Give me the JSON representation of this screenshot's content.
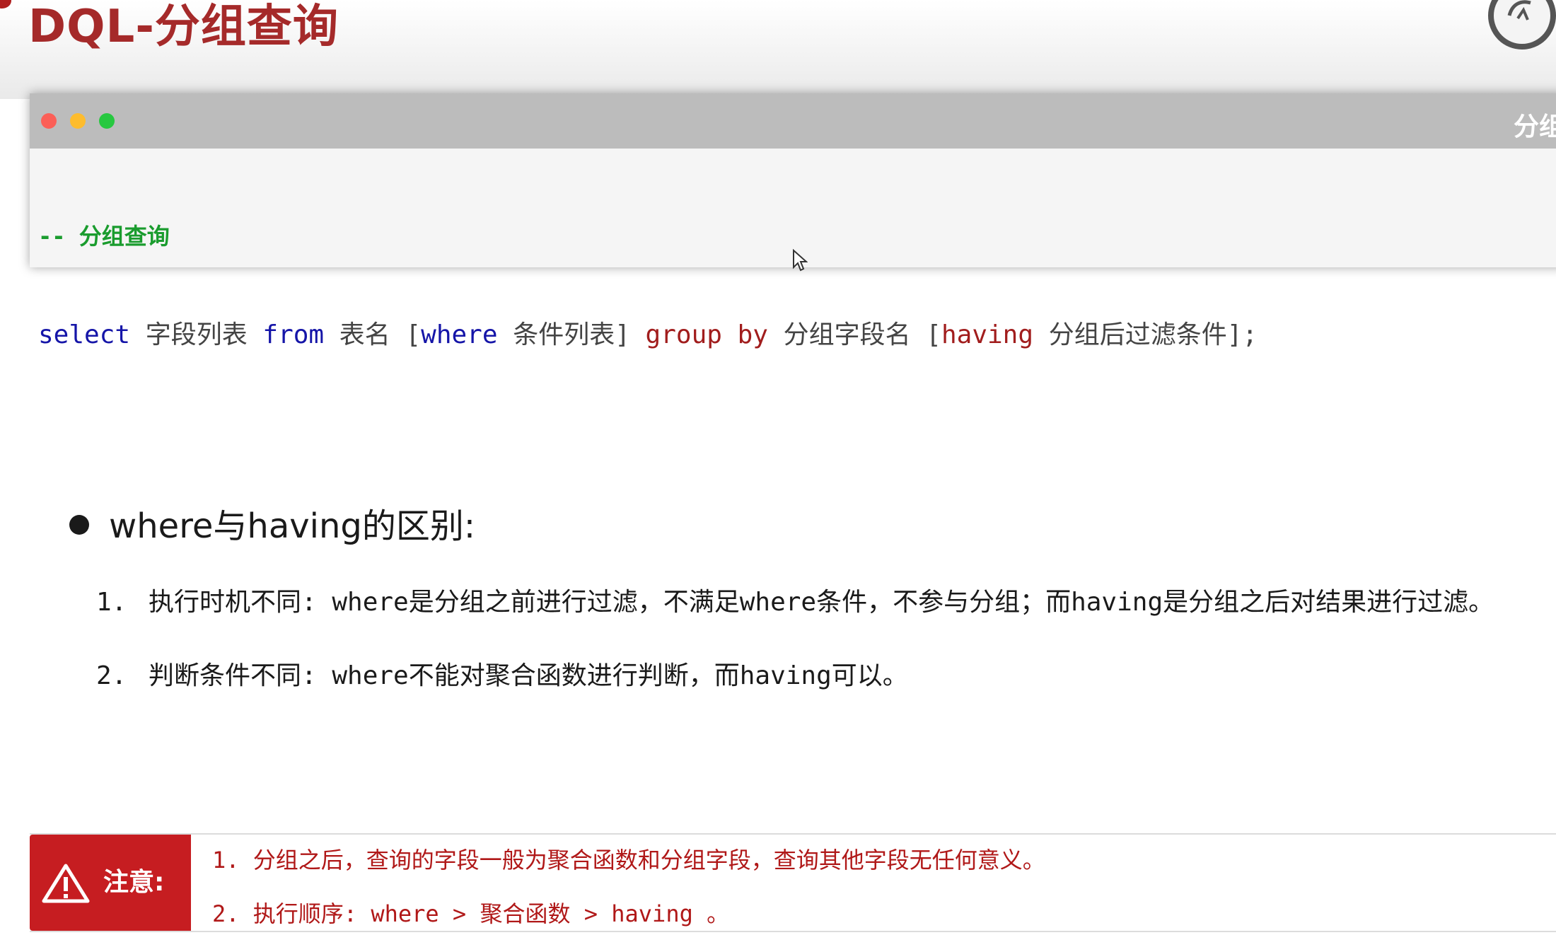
{
  "header": {
    "title": "DQL-分组查询"
  },
  "code_window": {
    "title": "分组",
    "comment": "-- 分组查询",
    "code": {
      "select": "select",
      "fields": " 字段列表 ",
      "from": "from",
      "table": " 表名 [",
      "where": "where",
      "conditions": " 条件列表] ",
      "group_by": "group by",
      "group_field": " 分组字段名 [",
      "having": "having",
      "having_cond": " 分组后过滤条件];"
    }
  },
  "section": {
    "heading": "where与having的区别:",
    "points": [
      {
        "num": "1.",
        "text": "执行时机不同: where是分组之前进行过滤，不满足where条件，不参与分组；而having是分组之后对结果进行过滤。"
      },
      {
        "num": "2.",
        "text": "判断条件不同: where不能对聚合函数进行判断，而having可以。"
      }
    ]
  },
  "note": {
    "label": "注意:",
    "lines": [
      "1. 分组之后，查询的字段一般为聚合函数和分组字段，查询其他字段无任何意义。",
      "2. 执行顺序: where  >  聚合函数 > having 。"
    ]
  },
  "colors": {
    "title_red": "#a52a2a",
    "keyword_blue": "#1515a8",
    "keyword_red": "#a11d1d",
    "comment_green": "#1a9c2e",
    "note_red": "#c61d21"
  },
  "icons": {
    "warning": "warning-triangle-icon",
    "cursor": "mouse-pointer-icon",
    "logo": "logo-icon"
  }
}
